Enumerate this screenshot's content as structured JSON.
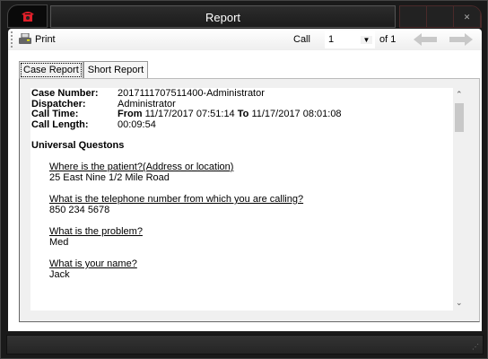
{
  "window": {
    "title": "Report",
    "icon": "phone-icon",
    "accent": "#e0202a"
  },
  "toolbar": {
    "print_label": "Print",
    "call_label": "Call",
    "call_value": "1",
    "of_label": "of 1"
  },
  "tabs": [
    {
      "label": "Case Report",
      "active": true
    },
    {
      "label": "Short Report",
      "active": false
    }
  ],
  "report": {
    "fields": [
      {
        "key": "Case Number:",
        "value": "2017111707511400-Administrator"
      },
      {
        "key": "Dispatcher:",
        "value": "Administrator"
      },
      {
        "key": "Call Length:",
        "value": "00:09:54"
      }
    ],
    "call_time": {
      "key": "Call Time:",
      "from_label": "From",
      "from": "11/17/2017 07:51:14",
      "to_label": "To",
      "to": "11/17/2017 08:01:08"
    },
    "section_title": "Universal Questons",
    "questions": [
      {
        "q": "Where is the patient?(Address or location)",
        "a": "25 East Nine 1/2 Mile Road"
      },
      {
        "q": "What is the telephone number from which you are calling?",
        "a": "850 234 5678"
      },
      {
        "q": "What is the problem?",
        "a": "Med"
      },
      {
        "q": "What is your name?",
        "a": "Jack"
      }
    ]
  }
}
